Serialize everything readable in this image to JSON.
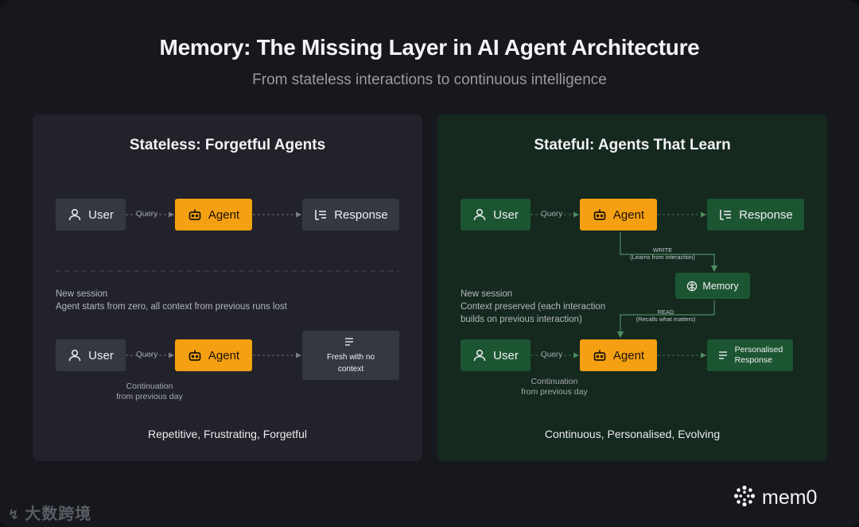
{
  "header": {
    "title": "Memory: The Missing Layer in AI Agent Architecture",
    "subtitle": "From stateless interactions to continuous intelligence"
  },
  "stateless": {
    "title": "Stateless: Forgetful Agents",
    "row1": {
      "user": "User",
      "query": "Query",
      "agent": "Agent",
      "response": "Response"
    },
    "note_line1": "New session",
    "note_line2": "Agent starts from zero, all context from previous runs lost",
    "row2": {
      "user": "User",
      "query": "Query",
      "agent": "Agent",
      "response_line1": "Fresh with no",
      "response_line2": "context"
    },
    "continuation_line1": "Continuation",
    "continuation_line2": "from previous day",
    "footer": "Repetitive, Frustrating, Forgetful"
  },
  "stateful": {
    "title": "Stateful: Agents That Learn",
    "row1": {
      "user": "User",
      "query": "Query",
      "agent": "Agent",
      "response": "Response"
    },
    "write_label": "WRITE",
    "write_sub": "(Learns from interaction)",
    "memory": "Memory",
    "read_label": "READ",
    "read_sub": "(Recalls what matters)",
    "note_line1": "New session",
    "note_line2": "Context preserved (each interaction",
    "note_line3": "builds on previous interaction)",
    "row2": {
      "user": "User",
      "query": "Query",
      "agent": "Agent",
      "response_line1": "Personalised",
      "response_line2": "Response"
    },
    "continuation_line1": "Continuation",
    "continuation_line2": "from previous day",
    "footer": "Continuous, Personalised, Evolving"
  },
  "branding": {
    "logo_text": "mem0",
    "logo_icon": "mem0-logo-icon",
    "watermark": "大数跨境"
  },
  "colors": {
    "background": "#17181d",
    "panel_left": "#22232a",
    "panel_right": "#15291f",
    "agent": "#f5a012",
    "node_gray": "#353841",
    "node_green": "#1c5532"
  }
}
